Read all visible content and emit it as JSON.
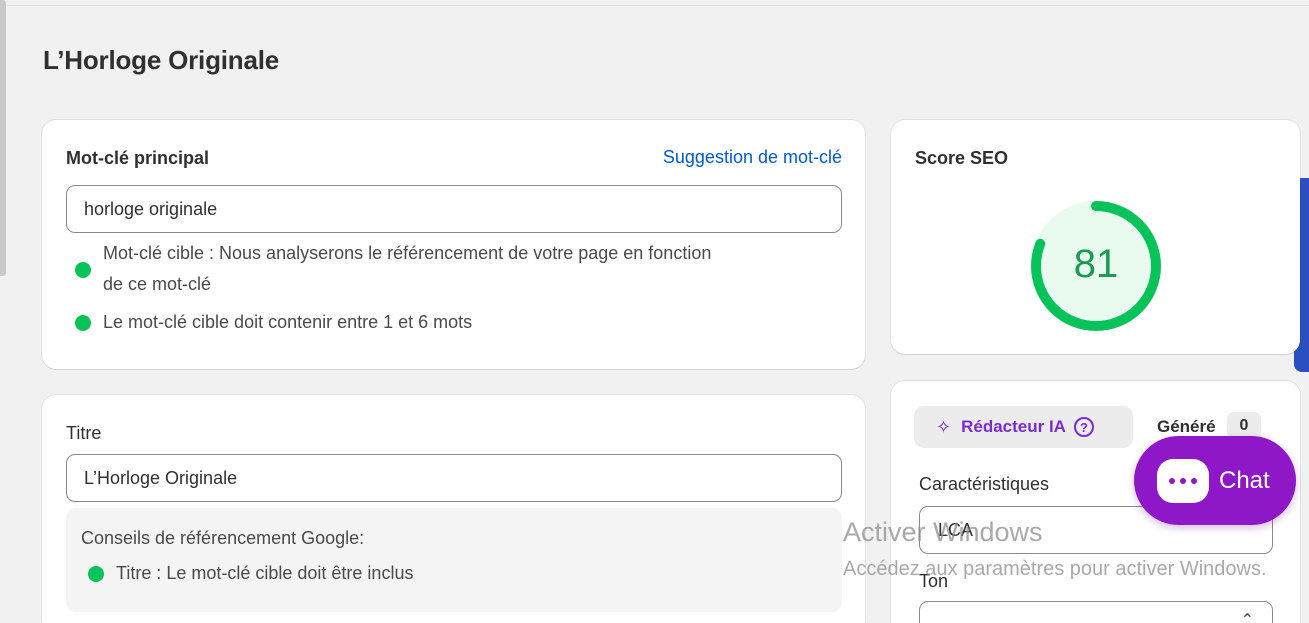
{
  "page_title": "L’Horloge Originale",
  "keyword_card": {
    "heading": "Mot-clé principal",
    "suggestion_link": "Suggestion de mot-clé",
    "input_value": "horloge originale",
    "hint_1_line_1": "Mot-clé cible : Nous analyserons le référencement de votre page en fonction",
    "hint_1_line_2": "de ce mot-clé",
    "hint_2": "Le mot-clé cible doit contenir entre 1 et 6 mots"
  },
  "title_card": {
    "label": "Titre",
    "input_value": "L’Horloge Originale",
    "tips_heading": "Conseils de référencement Google:",
    "tip_1": "Titre : Le mot-clé cible doit être inclus"
  },
  "score_card": {
    "heading": "Score SEO",
    "score": "81",
    "score_value": 81,
    "score_color": "#08c35a"
  },
  "ai_card": {
    "writer_label": "Rédacteur IA",
    "writer_icon": "sparkle-icon",
    "help_icon": "question-circle-icon",
    "help_glyph": "?",
    "generated_label": "Généré",
    "generated_count": "0",
    "features_label": "Caractéristiques",
    "features_value": "LCA",
    "tone_label": "Ton",
    "tone_value": ""
  },
  "chat_widget": {
    "label": "Chat",
    "icon": "chat-bubble-icon",
    "color": "#8e17c8"
  },
  "windows_watermark": {
    "title": "Activer Windows",
    "subtitle": "Accédez aux paramètres pour activer Windows."
  },
  "colors": {
    "link": "#005bd3",
    "success": "#08c35a",
    "ai_purple": "#7b2ad8",
    "side_accent": "#2a4fc0"
  }
}
